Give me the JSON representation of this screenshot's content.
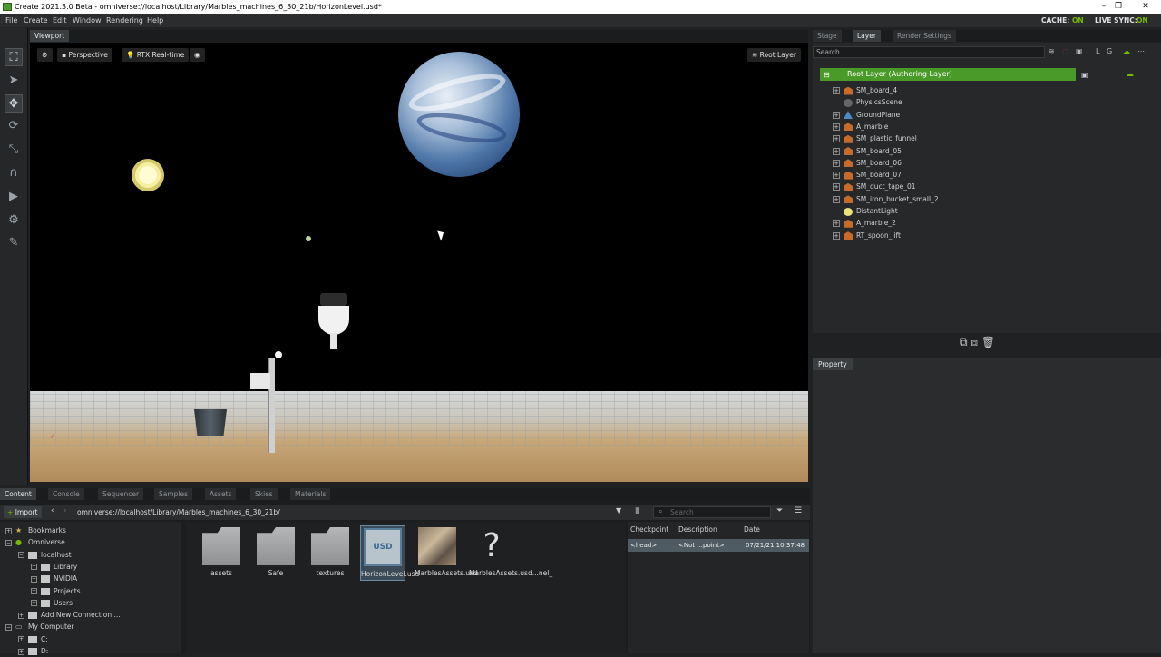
{
  "window": {
    "title": "Create 2021.3.0 Beta - omniverse://localhost/Library/Marbles_machines_6_30_21b/HorizonLevel.usd*",
    "buttons": {
      "minimize": "–",
      "maximize": "❐",
      "close": "✕"
    }
  },
  "menu": {
    "items": [
      "File",
      "Create",
      "Edit",
      "Window",
      "Rendering",
      "Help"
    ],
    "cache_label": "CACHE:",
    "cache_value": "ON",
    "live_sync_label": "LIVE SYNC:",
    "live_sync_value": "ON"
  },
  "viewport": {
    "tab": "Viewport",
    "camera": "Perspective",
    "renderer": "RTX Real-time",
    "root_layer": "Root Layer"
  },
  "stage_tabs": [
    "Stage",
    "Layer",
    "Render Settings"
  ],
  "stage": {
    "search_placeholder": "Search",
    "root_layer_label": "Root Layer (Authoring Layer)",
    "items": [
      {
        "label": "SM_board_4",
        "type": "mesh",
        "expandable": true
      },
      {
        "label": "PhysicsScene",
        "type": "scene",
        "expandable": false
      },
      {
        "label": "GroundPlane",
        "type": "xform",
        "expandable": true
      },
      {
        "label": "A_marble",
        "type": "mesh",
        "expandable": true
      },
      {
        "label": "SM_plastic_funnel",
        "type": "mesh",
        "expandable": true
      },
      {
        "label": "SM_board_05",
        "type": "mesh",
        "expandable": true
      },
      {
        "label": "SM_board_06",
        "type": "mesh",
        "expandable": true
      },
      {
        "label": "SM_board_07",
        "type": "mesh",
        "expandable": true
      },
      {
        "label": "SM_duct_tape_01",
        "type": "mesh",
        "expandable": true
      },
      {
        "label": "SM_iron_bucket_small_2",
        "type": "mesh",
        "expandable": true
      },
      {
        "label": "DistantLight",
        "type": "light",
        "expandable": false
      },
      {
        "label": "A_marble_2",
        "type": "mesh",
        "expandable": true
      },
      {
        "label": "RT_spoon_lift",
        "type": "mesh",
        "expandable": true
      }
    ]
  },
  "property": {
    "tab": "Property"
  },
  "content_tabs": [
    "Content",
    "Console",
    "Sequencer",
    "Samples",
    "Assets",
    "Skies",
    "Materials"
  ],
  "content": {
    "import_label": "Import",
    "path": "omniverse://localhost/Library/Marbles_machines_6_30_21b/",
    "search_placeholder": "Search",
    "tree": [
      {
        "label": "Bookmarks",
        "level": 0
      },
      {
        "label": "Omniverse",
        "level": 0
      },
      {
        "label": "localhost",
        "level": 1
      },
      {
        "label": "Library",
        "level": 2
      },
      {
        "label": "NVIDIA",
        "level": 2
      },
      {
        "label": "Projects",
        "level": 2
      },
      {
        "label": "Users",
        "level": 2
      },
      {
        "label": "Add New Connection ...",
        "level": 1
      },
      {
        "label": "My Computer",
        "level": 0
      },
      {
        "label": "C:",
        "level": 1
      },
      {
        "label": "D:",
        "level": 1
      }
    ],
    "files": [
      {
        "label": "assets",
        "kind": "folder"
      },
      {
        "label": "Safe",
        "kind": "folder"
      },
      {
        "label": "textures",
        "kind": "folder"
      },
      {
        "label": "HorizonLevel.usd",
        "kind": "usd",
        "selected": true
      },
      {
        "label": "MarblesAssets.usd",
        "kind": "image"
      },
      {
        "label": "MarblesAssets.usd...nel_",
        "kind": "unknown"
      }
    ],
    "checkpoint_headers": [
      "Checkpoint",
      "Description",
      "Date"
    ],
    "checkpoint_row": {
      "checkpoint": "<head>",
      "description": "<Not ...point>",
      "date": "07/21/21 10:37:48"
    },
    "usd_badge": "USD"
  }
}
